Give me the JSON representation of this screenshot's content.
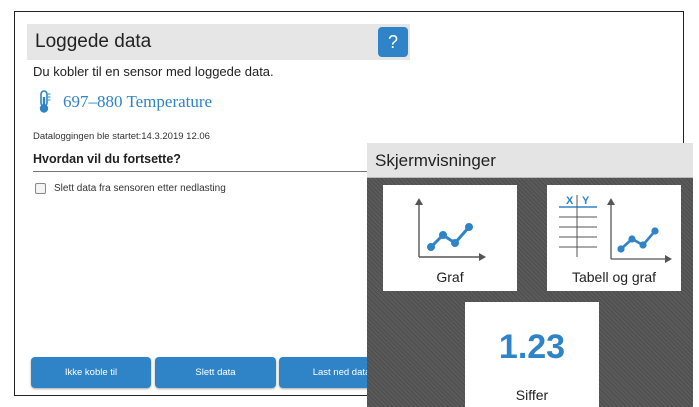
{
  "dialog": {
    "title": "Loggede data",
    "help_label": "?",
    "intro": "Du kobler til en sensor med loggede data.",
    "sensor": {
      "icon": "thermometer-icon",
      "name": "697–880  Temperature"
    },
    "started": "Dataloggingen ble startet:14.3.2019 12.06",
    "question": "Hvordan vil du fortsette?",
    "checkbox": {
      "label": "Slett data fra sensoren etter nedlasting",
      "checked": false
    },
    "buttons": {
      "skip": "Ikke koble til",
      "delete": "Slett data",
      "download": "Last ned data"
    }
  },
  "overlay": {
    "title": "Skjermvisninger",
    "cards": [
      {
        "label": "Graf",
        "icon": "graph-icon"
      },
      {
        "label": "Tabell og graf",
        "icon": "table-graph-icon",
        "table_headers": [
          "X",
          "Y"
        ]
      },
      {
        "label": "Siffer",
        "value": "1.23"
      }
    ]
  },
  "colors": {
    "accent": "#2e84c6",
    "header_bg": "#e6e6e6",
    "overlay_bg": "#555555"
  }
}
